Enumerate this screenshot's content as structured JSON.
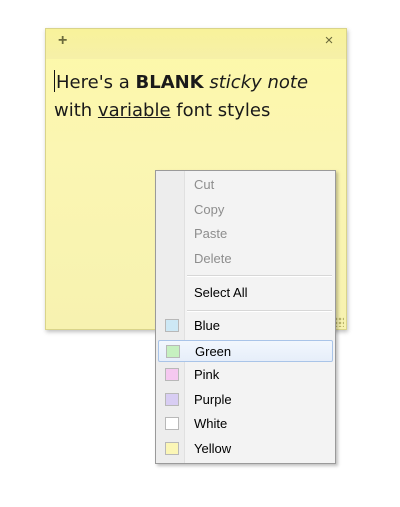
{
  "note": {
    "add_glyph": "+",
    "close_glyph": "×",
    "text_parts": [
      "Here's a ",
      "BLANK",
      " ",
      "sticky note",
      " with ",
      "variable",
      " font styles"
    ],
    "background_color": "#fdf8a8"
  },
  "context_menu": {
    "edit_items": [
      "Cut",
      "Copy",
      "Paste",
      "Delete"
    ],
    "select_all": "Select All",
    "colors": [
      {
        "label": "Blue",
        "swatch": "#cde8f5"
      },
      {
        "label": "Green",
        "swatch": "#c6f0c0"
      },
      {
        "label": "Pink",
        "swatch": "#f5c8f0"
      },
      {
        "label": "Purple",
        "swatch": "#d8cdf3"
      },
      {
        "label": "White",
        "swatch": "#ffffff"
      },
      {
        "label": "Yellow",
        "swatch": "#fbf6b6"
      }
    ],
    "highlighted": "Green"
  }
}
